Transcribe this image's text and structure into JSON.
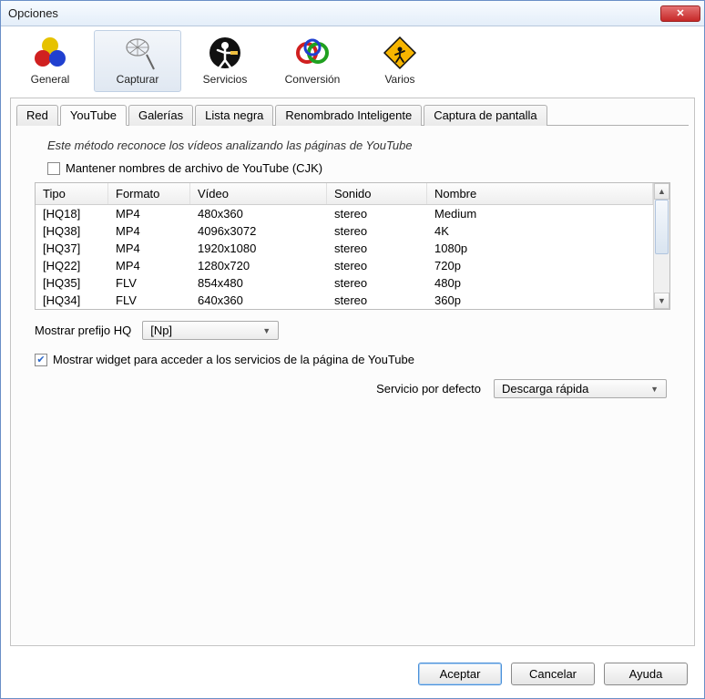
{
  "window": {
    "title": "Opciones"
  },
  "toolbar": [
    {
      "name": "general",
      "label": "General"
    },
    {
      "name": "capturar",
      "label": "Capturar",
      "active": true
    },
    {
      "name": "servicios",
      "label": "Servicios"
    },
    {
      "name": "conversion",
      "label": "Conversión"
    },
    {
      "name": "varios",
      "label": "Varios"
    }
  ],
  "tabs": [
    {
      "name": "red",
      "label": "Red"
    },
    {
      "name": "youtube",
      "label": "YouTube",
      "active": true
    },
    {
      "name": "galerias",
      "label": "Galerías"
    },
    {
      "name": "lista-negra",
      "label": "Lista negra"
    },
    {
      "name": "renombrado",
      "label": "Renombrado Inteligente"
    },
    {
      "name": "captura-pantalla",
      "label": "Captura de pantalla"
    }
  ],
  "panel": {
    "hint": "Este método reconoce los vídeos analizando las páginas de YouTube",
    "cjk_checkbox": {
      "label": "Mantener nombres de archivo de YouTube (CJK)",
      "checked": false
    },
    "table": {
      "headers": [
        "Tipo",
        "Formato",
        "Vídeo",
        "Sonido",
        "Nombre"
      ],
      "rows": [
        [
          "[HQ18]",
          "MP4",
          "480x360",
          "stereo",
          "Medium"
        ],
        [
          "[HQ38]",
          "MP4",
          "4096x3072",
          "stereo",
          "4K"
        ],
        [
          "[HQ37]",
          "MP4",
          "1920x1080",
          "stereo",
          "1080p"
        ],
        [
          "[HQ22]",
          "MP4",
          "1280x720",
          "stereo",
          "720p"
        ],
        [
          "[HQ35]",
          "FLV",
          "854x480",
          "stereo",
          "480p"
        ],
        [
          "[HQ34]",
          "FLV",
          "640x360",
          "stereo",
          "360p"
        ]
      ]
    },
    "prefix": {
      "label": "Mostrar prefijo HQ",
      "value": "[Np]"
    },
    "widget_checkbox": {
      "label": "Mostrar widget para acceder a los servicios de la página de YouTube",
      "checked": true
    },
    "service": {
      "label": "Servicio por defecto",
      "value": "Descarga rápida"
    }
  },
  "buttons": {
    "ok": "Aceptar",
    "cancel": "Cancelar",
    "help": "Ayuda"
  }
}
